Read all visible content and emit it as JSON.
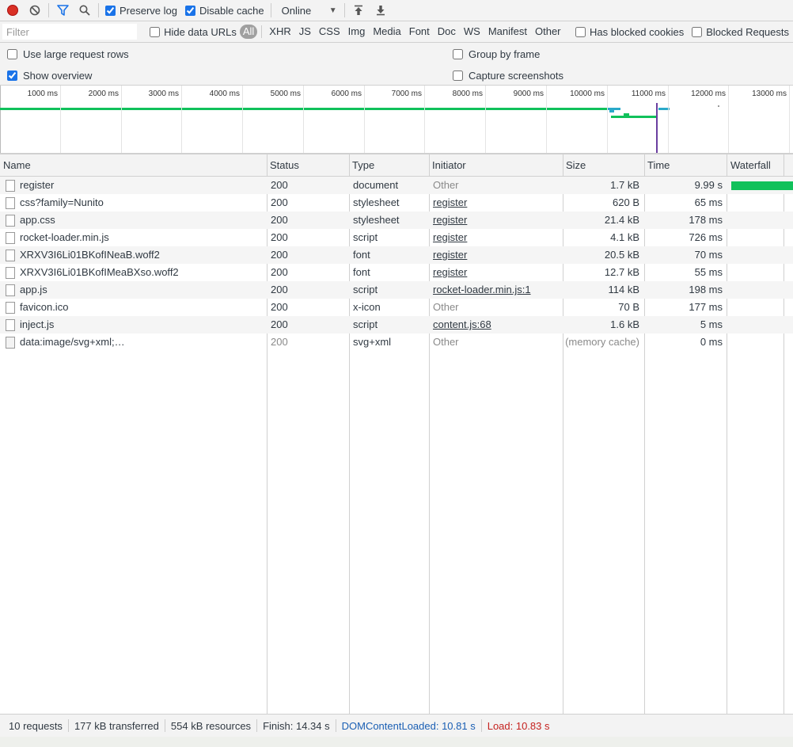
{
  "toolbar": {
    "preserve_log_label": "Preserve log",
    "preserve_log_checked": true,
    "disable_cache_label": "Disable cache",
    "disable_cache_checked": true,
    "throttle_value": "Online",
    "colors": {
      "record": "#d93025",
      "filter_icon": "#1a73e8"
    }
  },
  "filterbar": {
    "filter_placeholder": "Filter",
    "hide_data_urls_label": "Hide data URLs",
    "types": [
      "All",
      "XHR",
      "JS",
      "CSS",
      "Img",
      "Media",
      "Font",
      "Doc",
      "WS",
      "Manifest",
      "Other"
    ],
    "active_type": "All",
    "has_blocked_cookies_label": "Has blocked cookies",
    "blocked_requests_label": "Blocked Requests"
  },
  "settings": {
    "use_large_rows_label": "Use large request rows",
    "show_overview_label": "Show overview",
    "show_overview_checked": true,
    "group_by_frame_label": "Group by frame",
    "capture_screenshots_label": "Capture screenshots"
  },
  "overview": {
    "tick_labels": [
      "1000 ms",
      "2000 ms",
      "3000 ms",
      "4000 ms",
      "5000 ms",
      "6000 ms",
      "7000 ms",
      "8000 ms",
      "9000 ms",
      "10000 ms",
      "11000 ms",
      "12000 ms",
      "13000 ms"
    ],
    "colors": {
      "document": "#11c15b",
      "resource": "#2aa9c9",
      "marker": "#6b3fa0"
    }
  },
  "table": {
    "columns": [
      "Name",
      "Status",
      "Type",
      "Initiator",
      "Size",
      "Time",
      "Waterfall"
    ],
    "rows": [
      {
        "name": "register",
        "status": "200",
        "type": "document",
        "initiator": "Other",
        "initiator_link": false,
        "size": "1.7 kB",
        "time": "9.99 s",
        "icon": "document-icon"
      },
      {
        "name": "css?family=Nunito",
        "status": "200",
        "type": "stylesheet",
        "initiator": "register",
        "initiator_link": true,
        "size": "620 B",
        "time": "65 ms",
        "icon": "document-icon"
      },
      {
        "name": "app.css",
        "status": "200",
        "type": "stylesheet",
        "initiator": "register",
        "initiator_link": true,
        "size": "21.4 kB",
        "time": "178 ms",
        "icon": "document-icon"
      },
      {
        "name": "rocket-loader.min.js",
        "status": "200",
        "type": "script",
        "initiator": "register",
        "initiator_link": true,
        "size": "4.1 kB",
        "time": "726 ms",
        "icon": "document-icon"
      },
      {
        "name": "XRXV3I6Li01BKofINeaB.woff2",
        "status": "200",
        "type": "font",
        "initiator": "register",
        "initiator_link": true,
        "size": "20.5 kB",
        "time": "70 ms",
        "icon": "document-icon"
      },
      {
        "name": "XRXV3I6Li01BKofIMeaBXso.woff2",
        "status": "200",
        "type": "font",
        "initiator": "register",
        "initiator_link": true,
        "size": "12.7 kB",
        "time": "55 ms",
        "icon": "document-icon"
      },
      {
        "name": "app.js",
        "status": "200",
        "type": "script",
        "initiator": "rocket-loader.min.js:1",
        "initiator_link": true,
        "size": "114 kB",
        "time": "198 ms",
        "icon": "document-icon"
      },
      {
        "name": "favicon.ico",
        "status": "200",
        "type": "x-icon",
        "initiator": "Other",
        "initiator_link": false,
        "size": "70 B",
        "time": "177 ms",
        "icon": "document-icon"
      },
      {
        "name": "inject.js",
        "status": "200",
        "type": "script",
        "initiator": "content.js:68",
        "initiator_link": true,
        "size": "1.6 kB",
        "time": "5 ms",
        "icon": "document-icon"
      },
      {
        "name": "data:image/svg+xml;…",
        "status": "200",
        "type": "svg+xml",
        "initiator": "Other",
        "initiator_link": false,
        "size": "(memory cache)",
        "time": "0 ms",
        "icon": "image-icon",
        "dimmed": true
      }
    ]
  },
  "statusbar": {
    "requests": "10 requests",
    "transferred": "177 kB transferred",
    "resources": "554 kB resources",
    "finish": "Finish: 14.34 s",
    "dom_content_loaded": "DOMContentLoaded: 10.81 s",
    "load": "Load: 10.83 s",
    "colors": {
      "dom_content_loaded": "#1a5fb4",
      "load": "#c5221f"
    }
  }
}
